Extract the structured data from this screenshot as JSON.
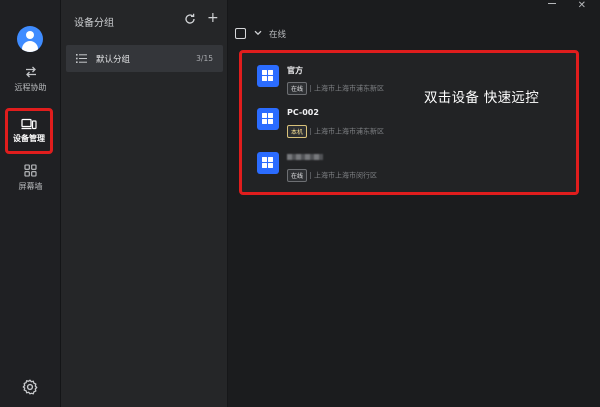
{
  "rail": {
    "items": [
      {
        "id": "remote",
        "label": "远程协助",
        "icon": "swap-arrows-icon"
      },
      {
        "id": "devices",
        "label": "设备管理",
        "icon": "device-icon",
        "active": true
      },
      {
        "id": "wall",
        "label": "屏幕墙",
        "icon": "grid-icon"
      }
    ],
    "settings_icon": "gear-icon"
  },
  "groups": {
    "title": "设备分组",
    "items": [
      {
        "name": "默认分组",
        "count": "3/15"
      }
    ]
  },
  "main": {
    "filter": {
      "label": "在线"
    },
    "hint": "双击设备 快速远控",
    "devices": [
      {
        "name": "官方",
        "status": "在线",
        "location": "上海市上海市浦东新区"
      },
      {
        "name": "PC-002",
        "status": "本机",
        "location": "上海市上海市浦东新区"
      },
      {
        "name": "",
        "status": "在线",
        "location": "上海市上海市闵行区"
      }
    ]
  },
  "colors": {
    "accent": "#2b6cff",
    "highlight": "#e01d1d",
    "local_badge": "#d9c27a"
  }
}
